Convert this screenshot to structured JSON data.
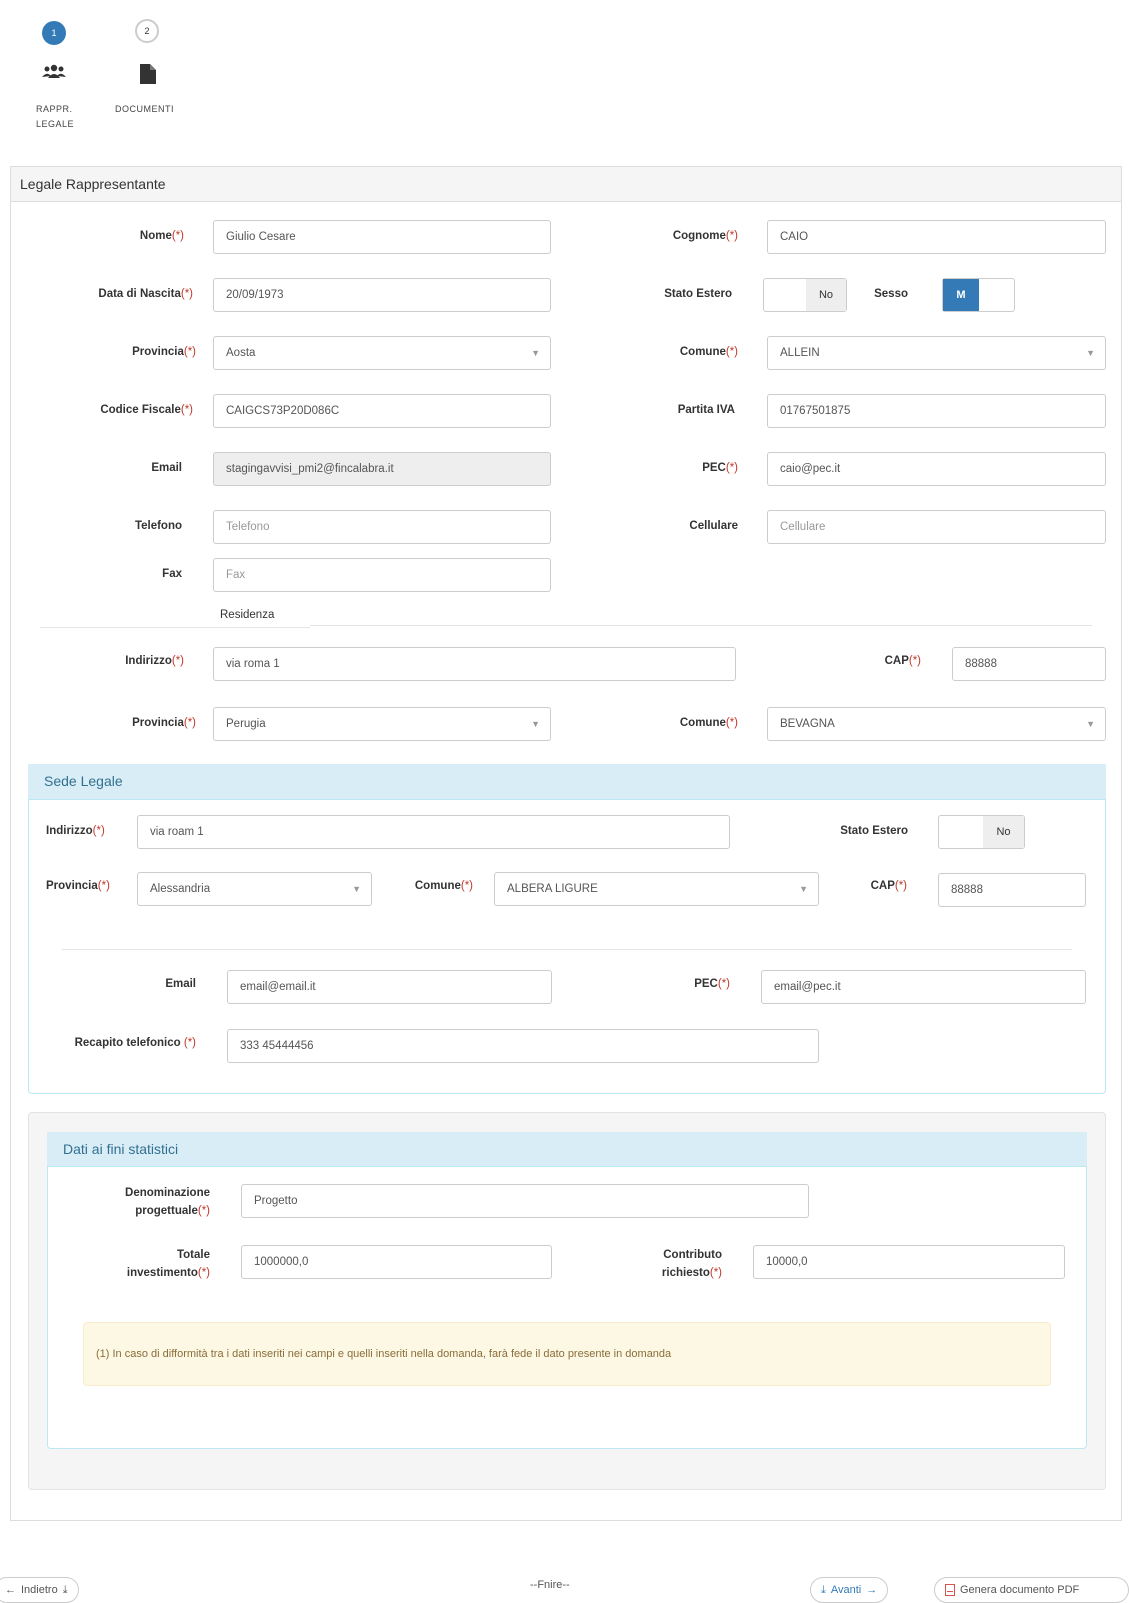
{
  "wizard": {
    "steps": [
      {
        "number": "1",
        "icon": "users-icon",
        "label_line1": "RAPPR.",
        "label_line2": "LEGALE"
      },
      {
        "number": "2",
        "icon": "document-icon",
        "label_line1": "DOCUMENTI",
        "label_line2": ""
      }
    ]
  },
  "legale": {
    "title": "Legale Rappresentante",
    "nome": {
      "label": "Nome",
      "value": "Giulio Cesare"
    },
    "cognome": {
      "label": "Cognome",
      "value": "CAIO"
    },
    "data_nascita": {
      "label": "Data di Nascita",
      "value": "20/09/1973"
    },
    "stato_estero": {
      "label": "Stato Estero",
      "value": "No"
    },
    "sesso": {
      "label": "Sesso",
      "value": "M"
    },
    "provincia": {
      "label": "Provincia",
      "value": "Aosta"
    },
    "comune": {
      "label": "Comune",
      "value": "ALLEIN"
    },
    "codice_fiscale": {
      "label": "Codice Fiscale",
      "value": "CAIGCS73P20D086C"
    },
    "partita_iva": {
      "label": "Partita IVA",
      "value": "01767501875"
    },
    "email": {
      "label": "Email",
      "value": "stagingavvisi_pmi2@fincalabra.it"
    },
    "pec": {
      "label": "PEC",
      "value": "caio@pec.it"
    },
    "telefono": {
      "label": "Telefono",
      "placeholder": "Telefono"
    },
    "cellulare": {
      "label": "Cellulare",
      "placeholder": "Cellulare"
    },
    "fax": {
      "label": "Fax",
      "placeholder": "Fax"
    },
    "residenza_title": "Residenza",
    "indirizzo": {
      "label": "Indirizzo",
      "value": "via roma 1"
    },
    "cap": {
      "label": "CAP",
      "value": "88888"
    },
    "res_provincia": {
      "label": "Provincia",
      "value": "Perugia"
    },
    "res_comune": {
      "label": "Comune",
      "value": "BEVAGNA"
    }
  },
  "sede": {
    "title": "Sede Legale",
    "indirizzo": {
      "label": "Indirizzo",
      "value": "via roam 1"
    },
    "stato_estero": {
      "label": "Stato Estero",
      "value": "No"
    },
    "provincia": {
      "label": "Provincia",
      "value": "Alessandria"
    },
    "comune": {
      "label": "Comune",
      "value": "ALBERA LIGURE"
    },
    "cap": {
      "label": "CAP",
      "value": "88888"
    },
    "email": {
      "label": "Email",
      "value": "email@email.it"
    },
    "pec": {
      "label": "PEC",
      "value": "email@pec.it"
    },
    "recapito": {
      "label": "Recapito telefonico ",
      "value": "333 45444456"
    }
  },
  "statistici": {
    "title": "Dati ai fini statistici",
    "denominazione": {
      "label_line1": "Denominazione",
      "label_line2": "progettuale",
      "value": "Progetto"
    },
    "totale": {
      "label_line1": "Totale",
      "label_line2": "investimento",
      "value": "1000000,0"
    },
    "contributo": {
      "label_line1": "Contributo",
      "label_line2": "richiesto",
      "value": "10000,0"
    },
    "note": "(1) In caso di difformità tra i dati inseriti nei campi e quelli inseriti nella domanda, farà fede il dato presente in domanda"
  },
  "required_mark": "(*)",
  "footer": {
    "back": "Indietro",
    "center": "--Fnire--",
    "next": "Avanti",
    "pdf": "Genera documento PDF"
  },
  "colors": {
    "primary": "#337ab7",
    "required": "#c0392b",
    "info_bg": "#d9edf7",
    "warning_bg": "#fcf8e3"
  }
}
